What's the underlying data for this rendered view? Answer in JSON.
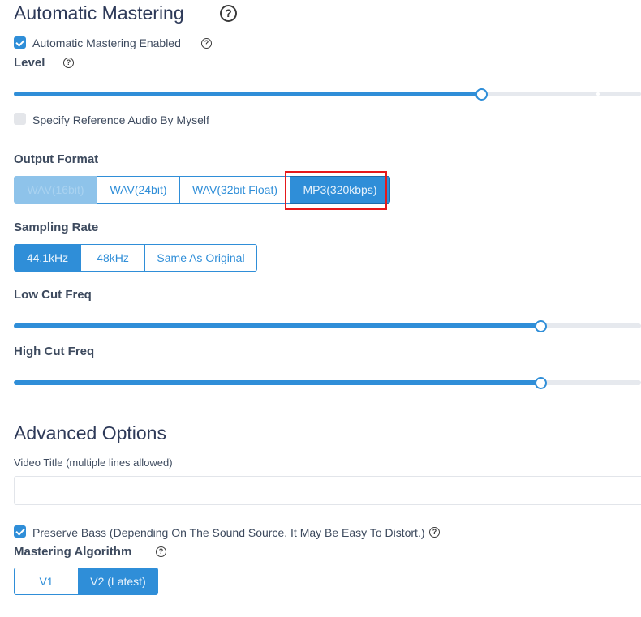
{
  "automatic_mastering": {
    "title": "Automatic Mastering",
    "enabled_label": "Automatic Mastering Enabled",
    "enabled": true,
    "level_label": "Level",
    "level_value": 0.73,
    "reference_label": "Specify Reference Audio By Myself",
    "reference_enabled": false
  },
  "output_format": {
    "label": "Output Format",
    "options": [
      "WAV(16bit)",
      "WAV(24bit)",
      "WAV(32bit Float)",
      "MP3(320kbps)"
    ],
    "selected": "MP3(320kbps)"
  },
  "sampling_rate": {
    "label": "Sampling Rate",
    "options": [
      "44.1kHz",
      "48kHz",
      "Same As Original"
    ],
    "selected": "44.1kHz"
  },
  "low_cut": {
    "label": "Low Cut Freq",
    "value": 0.82
  },
  "high_cut": {
    "label": "High Cut Freq",
    "value": 0.82
  },
  "advanced": {
    "title": "Advanced Options",
    "video_title_label": "Video Title (multiple lines allowed)",
    "video_title_value": "",
    "preserve_bass_label": "Preserve Bass (Depending On The Sound Source, It May Be Easy To Distort.)",
    "preserve_bass": true,
    "algorithm_label": "Mastering Algorithm",
    "algorithm_options": [
      "V1",
      "V2 (Latest)"
    ],
    "algorithm_selected": "V2 (Latest)"
  },
  "colors": {
    "accent": "#2f8ed8",
    "highlight": "#e5191b"
  }
}
